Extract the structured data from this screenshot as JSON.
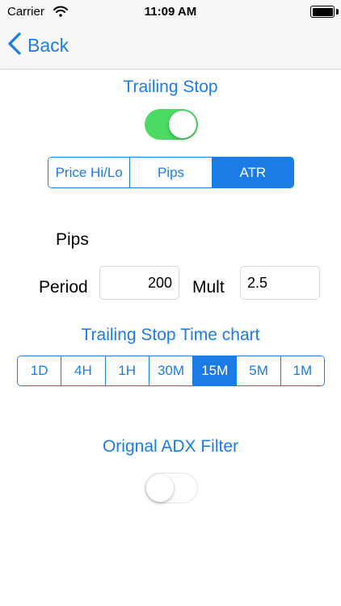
{
  "status_bar": {
    "carrier": "Carrier",
    "time": "11:09 AM"
  },
  "nav": {
    "back_label": "Back"
  },
  "trailing_stop": {
    "title": "Trailing Stop",
    "enabled": true,
    "modes": [
      "Price Hi/Lo",
      "Pips",
      "ATR"
    ],
    "selected_mode": "ATR"
  },
  "params": {
    "pips_label": "Pips",
    "period_label": "Period",
    "period_value": "200",
    "mult_label": "Mult",
    "mult_value": "2.5"
  },
  "timechart": {
    "title": "Trailing Stop Time chart",
    "options": [
      "1D",
      "4H",
      "1H",
      "30M",
      "15M",
      "5M",
      "1M"
    ],
    "selected": "15M"
  },
  "adx": {
    "title": "Orignal ADX Filter",
    "enabled": false
  },
  "colors": {
    "accent": "#1b7ce6",
    "toggle_on": "#4cd964"
  }
}
